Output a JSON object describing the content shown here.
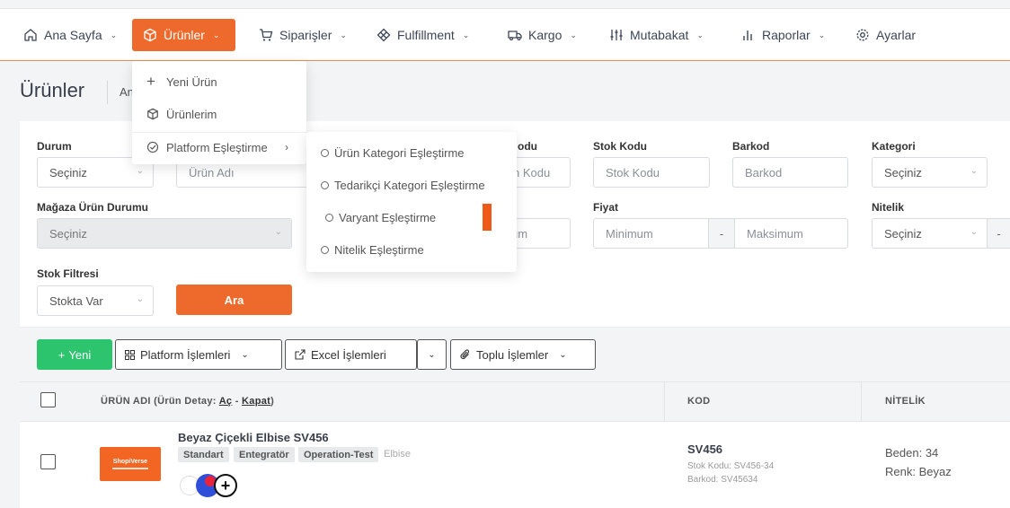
{
  "nav": {
    "items": [
      {
        "label": "Ana Sayfa",
        "icon": "home-icon"
      },
      {
        "label": "Ürünler",
        "icon": "box-icon"
      },
      {
        "label": "Siparişler",
        "icon": "cart-icon"
      },
      {
        "label": "Fulfillment",
        "icon": "package-icon"
      },
      {
        "label": "Kargo",
        "icon": "truck-icon"
      },
      {
        "label": "Mutabakat",
        "icon": "sliders-icon"
      },
      {
        "label": "Raporlar",
        "icon": "bar-chart-icon"
      },
      {
        "label": "Ayarlar",
        "icon": "gear-icon"
      }
    ],
    "accent": "#ee6a2c"
  },
  "page": {
    "title": "Ürünler",
    "crumb": "An"
  },
  "menu": {
    "new_product": "Yeni Ürün",
    "my_products": "Ürünlerim",
    "platform_matching": "Platform Eşleştirme"
  },
  "submenu": {
    "items": [
      "Ürün Kategori Eşleştirme",
      "Tedarikçi Kategori Eşleştirme",
      "Varyant Eşleştirme",
      "Nitelik Eşleştirme"
    ]
  },
  "filters": {
    "status_label": "Durum",
    "status_value": "Seçiniz",
    "product_name_placeholder": "Ürün Adı",
    "code_label_partial": "odu",
    "code_placeholder_partial": "n Kodu",
    "stock_code_label": "Stok Kodu",
    "stock_code_placeholder": "Stok Kodu",
    "barcode_label": "Barkod",
    "barcode_placeholder": "Barkod",
    "category_label": "Kategori",
    "category_value": "Seçiniz",
    "store_status_label": "Mağaza Ürün Durumu",
    "store_status_value": "Seçiniz",
    "min_partial": "um",
    "price_label": "Fiyat",
    "price_min": "Minimum",
    "price_dash": "-",
    "price_max": "Maksimum",
    "attribute_label": "Nitelik",
    "attribute_value": "Seçiniz",
    "attribute_dash": "-",
    "stock_filter_label": "Stok Filtresi",
    "stock_filter_value": "Stokta Var",
    "search_button": "Ara"
  },
  "toolbar": {
    "new": "Yeni",
    "platform_ops": "Platform İşlemleri",
    "excel_ops": "Excel İşlemleri",
    "bulk_ops": "Toplu İşlemler"
  },
  "table": {
    "col_name_prefix": "ÜRÜN ADI (Ürün Detay:",
    "col_name_open": "Aç",
    "col_name_sep": "-",
    "col_name_close": "Kapat",
    "col_name_suffix": ")",
    "col_code": "KOD",
    "col_attr": "NİTELİK",
    "rows": [
      {
        "name": "Beyaz Çiçekli Elbise SV456",
        "thumb_text": "ShopiVerse",
        "tags": [
          "Standart",
          "Entegratör",
          "Operation-Test"
        ],
        "category": "Elbise",
        "code": "SV456",
        "stock_code": "Stok Kodu: SV456-34",
        "barcode": "Barkod: SV45634",
        "attr1": "Beden: 34",
        "attr2": "Renk: Beyaz"
      }
    ]
  }
}
